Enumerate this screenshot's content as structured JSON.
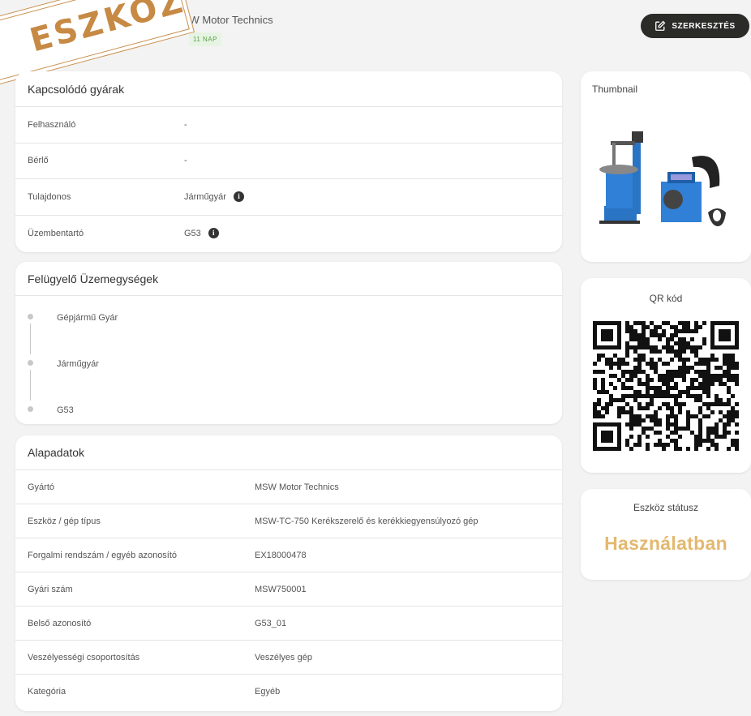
{
  "header": {
    "manufacturer": "MSW Motor Technics",
    "title_visible": "chnics",
    "badge": "11 NAP",
    "edit_button": "SZERKESZTÉS",
    "stamp": "ESZKÖZ"
  },
  "related_factories": {
    "title": "Kapcsolódó gyárak",
    "rows": [
      {
        "label": "Felhasználó",
        "value": "-"
      },
      {
        "label": "Bérlő",
        "value": "-"
      },
      {
        "label": "Tulajdonos",
        "value": "Járműgyár"
      },
      {
        "label": "Üzembentartó",
        "value": "G53"
      }
    ]
  },
  "supervising_units": {
    "title": "Felügyelő Üzemegységek",
    "items": [
      "Gépjármű Gyár",
      "Járműgyár",
      "G53"
    ]
  },
  "basic_data": {
    "title": "Alapadatok",
    "rows": [
      {
        "label": "Gyártó",
        "value": "MSW Motor Technics"
      },
      {
        "label": "Eszköz / gép típus",
        "value": "MSW-TC-750 Kerékszerelő és kerékkiegyensúlyozó gép"
      },
      {
        "label": "Forgalmi rendszám / egyéb azonosító",
        "value": "EX18000478"
      },
      {
        "label": "Gyári szám",
        "value": "MSW750001"
      },
      {
        "label": "Belső azonosító",
        "value": "G53_01"
      },
      {
        "label": "Veszélyességi csoportosítás",
        "value": "Veszélyes gép"
      },
      {
        "label": "Kategória",
        "value": "Egyéb"
      }
    ]
  },
  "thumbnail": {
    "title": "Thumbnail"
  },
  "qr": {
    "title": "QR kód"
  },
  "status": {
    "title": "Eszköz státusz",
    "value": "Használatban",
    "color": "#e3b86f"
  },
  "colors": {
    "badge_green": "#5aa04a",
    "button_dark": "#2b2b27",
    "stamp": "#c78a45"
  }
}
